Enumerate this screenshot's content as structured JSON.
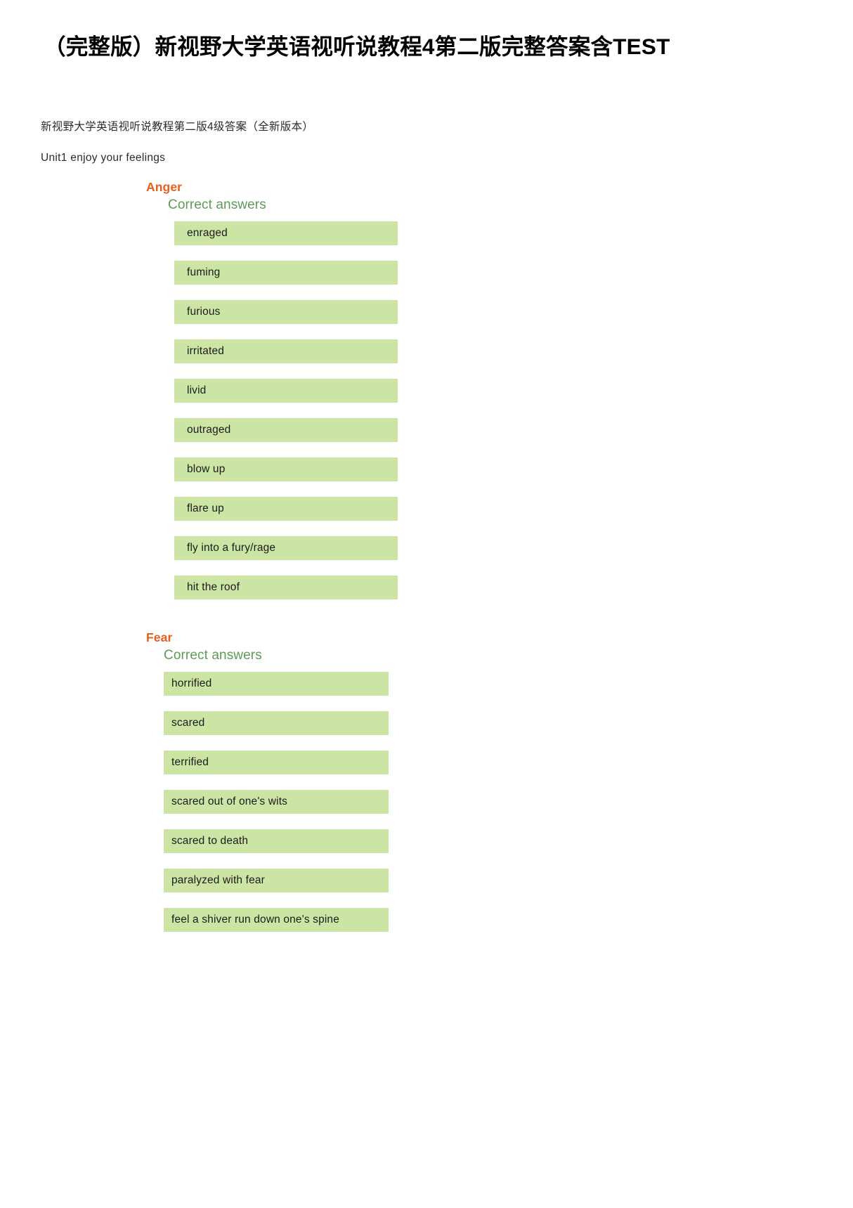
{
  "document": {
    "title": "（完整版）新视野大学英语视听说教程4第二版完整答案含TEST",
    "subtitle": "新视野大学英语视听说教程第二版4级答案（全新版本）",
    "unit_line": "Unit1 enjoy your feelings"
  },
  "colors": {
    "section_heading": "#E4601E",
    "correct_answers_label": "#5D9B57",
    "answer_box_background": "#CDE5A4",
    "answer_text": "#1b1b1b",
    "page_background": "#ffffff"
  },
  "sections": [
    {
      "heading": "Anger",
      "correct_answers_label": "Correct answers",
      "answers": [
        "enraged",
        "fuming",
        "furious",
        "irritated",
        "livid",
        "outraged",
        "blow up",
        "flare up",
        "fly into a fury/rage",
        "hit the roof"
      ]
    },
    {
      "heading": "Fear",
      "correct_answers_label": "Correct answers",
      "answers": [
        "horrified",
        "scared",
        "terrified",
        "scared out of one's wits",
        "scared to death",
        "paralyzed with fear",
        "feel a shiver run down one's spine"
      ]
    }
  ]
}
